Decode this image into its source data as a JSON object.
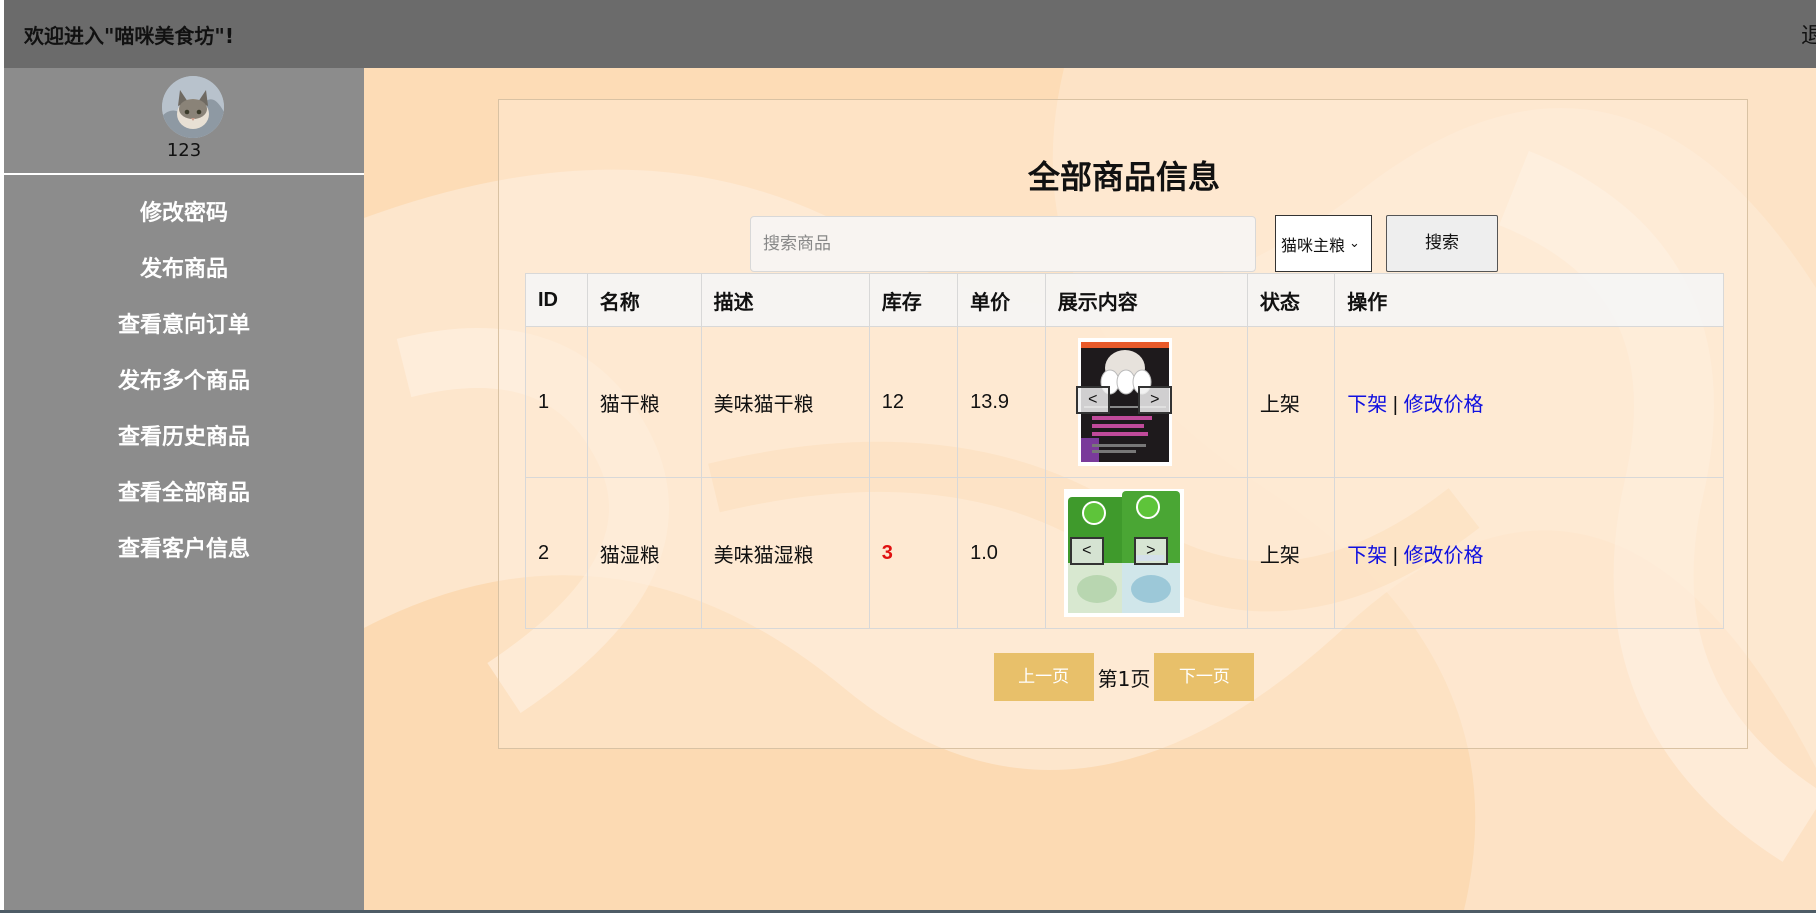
{
  "header": {
    "welcome": "欢迎进入\"喵咪美食坊\"!",
    "logout": "退"
  },
  "sidebar": {
    "username": "123",
    "menu": [
      {
        "label": "修改密码"
      },
      {
        "label": "发布商品"
      },
      {
        "label": "查看意向订单"
      },
      {
        "label": "发布多个商品"
      },
      {
        "label": "查看历史商品"
      },
      {
        "label": "查看全部商品"
      },
      {
        "label": "查看客户信息"
      }
    ]
  },
  "main": {
    "title": "全部商品信息",
    "search": {
      "placeholder": "搜索商品",
      "value": ""
    },
    "category": {
      "selected": "猫咪主粮"
    },
    "search_button": "搜索",
    "table": {
      "headers": [
        "ID",
        "名称",
        "描述",
        "库存",
        "单价",
        "展示内容",
        "状态",
        "操作"
      ],
      "rows": [
        {
          "id": "1",
          "name": "猫干粮",
          "desc": "美味猫干粮",
          "stock": "12",
          "price": "13.9",
          "status": "上架",
          "action_off": "下架",
          "action_sep": "|",
          "action_price": "修改价格",
          "prev": "<",
          "next": ">",
          "image": "dry-food-bag"
        },
        {
          "id": "2",
          "name": "猫湿粮",
          "desc": "美味猫湿粮",
          "stock": "3",
          "price": "1.0",
          "status": "上架",
          "action_off": "下架",
          "action_sep": "|",
          "action_price": "修改价格",
          "prev": "<",
          "next": ">",
          "image": "wet-food-bags"
        }
      ]
    },
    "pagination": {
      "prev": "上一页",
      "page_text": "第1页",
      "next": "下一页"
    }
  },
  "colors": {
    "topbar": "#6b6b6b",
    "sidebar": "#8c8c8c",
    "main_bg": "#fde4c6",
    "link": "#1010e0",
    "low_stock": "#e01010",
    "pager_button": "#e8c06a"
  }
}
